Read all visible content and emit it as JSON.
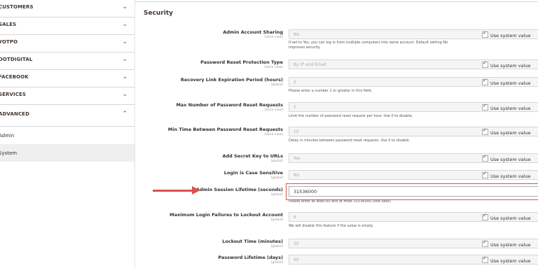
{
  "sidebar": {
    "sections": [
      {
        "label": "CUSTOMERS"
      },
      {
        "label": "SALES"
      },
      {
        "label": "YOTPO"
      },
      {
        "label": "DOTDIGITAL"
      },
      {
        "label": "FACEBOOK"
      },
      {
        "label": "SERVICES"
      },
      {
        "label": "ADVANCED"
      }
    ],
    "items": [
      {
        "label": "Admin"
      },
      {
        "label": "System"
      }
    ]
  },
  "main": {
    "section_title": "Security",
    "system_value_label": "Use system value",
    "rows": [
      {
        "label": "Admin Account Sharing",
        "scope": "[store view]",
        "value": "No",
        "note": "If set to Yes, you can log in from multiple computers into same account. Default setting No improves security."
      },
      {
        "label": "Password Reset Protection Type",
        "scope": "[store view]",
        "value": "By IP and Email",
        "note": ""
      },
      {
        "label": "Recovery Link Expiration Period (hours)",
        "scope": "[global]",
        "value": "2",
        "note": "Please enter a number 1 or greater in this field."
      },
      {
        "label": "Max Number of Password Reset Requests",
        "scope": "[store view]",
        "value": "5",
        "note": "Limit the number of password reset request per hour. Use 0 to disable."
      },
      {
        "label": "Min Time Between Password Reset Requests",
        "scope": "[store view]",
        "value": "10",
        "note": "Delay in minutes between password reset requests. Use 0 to disable."
      },
      {
        "label": "Add Secret Key to URLs",
        "scope": "[global]",
        "value": "Yes",
        "note": ""
      },
      {
        "label": "Login is Case Sensitive",
        "scope": "[global]",
        "value": "No",
        "note": ""
      },
      {
        "label": "Admin Session Lifetime (seconds)",
        "scope": "[global]",
        "value": "31536000",
        "note": "Please enter at least 60 and at most 31536000 (one year)."
      },
      {
        "label": "Maximum Login Failures to Lockout Account",
        "scope": "[global]",
        "value": "6",
        "note": "We will disable this feature if the value is empty."
      },
      {
        "label": "Lockout Time (minutes)",
        "scope": "[global]",
        "value": "30",
        "note": ""
      },
      {
        "label": "Password Lifetime (days)",
        "scope": "[global]",
        "value": "90",
        "note": ""
      }
    ]
  },
  "colors": {
    "highlight": "#d9534f"
  }
}
